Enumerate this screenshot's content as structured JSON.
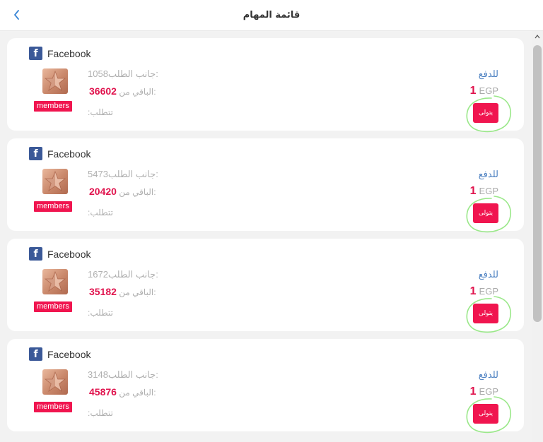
{
  "header": {
    "title": "قائمة المهام"
  },
  "colors": {
    "accent": "#f0154f",
    "link": "#4a7fc1",
    "facebook": "#3b5998",
    "annotation": "#9be88a"
  },
  "cards": [
    {
      "brand": "Facebook",
      "fb_glyph": "f",
      "badge": "members",
      "requester_label": "جانب الطلب:",
      "requester_value": "1058",
      "remaining_label": "الباقي من:",
      "remaining_value": "36602",
      "requires_label": ":تتطلب",
      "pay_label": "للدفع",
      "amount": "1",
      "currency": "EGP",
      "button": "يتولى"
    },
    {
      "brand": "Facebook",
      "fb_glyph": "f",
      "badge": "members",
      "requester_label": "جانب الطلب:",
      "requester_value": "5473",
      "remaining_label": "الباقي من:",
      "remaining_value": "20420",
      "requires_label": ":تتطلب",
      "pay_label": "للدفع",
      "amount": "1",
      "currency": "EGP",
      "button": "يتولى"
    },
    {
      "brand": "Facebook",
      "fb_glyph": "f",
      "badge": "members",
      "requester_label": "جانب الطلب:",
      "requester_value": "1672",
      "remaining_label": "الباقي من:",
      "remaining_value": "35182",
      "requires_label": ":تتطلب",
      "pay_label": "للدفع",
      "amount": "1",
      "currency": "EGP",
      "button": "يتولى"
    },
    {
      "brand": "Facebook",
      "fb_glyph": "f",
      "badge": "members",
      "requester_label": "جانب الطلب:",
      "requester_value": "3148",
      "remaining_label": "الباقي من:",
      "remaining_value": "45876",
      "requires_label": ":تتطلب",
      "pay_label": "للدفع",
      "amount": "1",
      "currency": "EGP",
      "button": "يتولى"
    }
  ]
}
